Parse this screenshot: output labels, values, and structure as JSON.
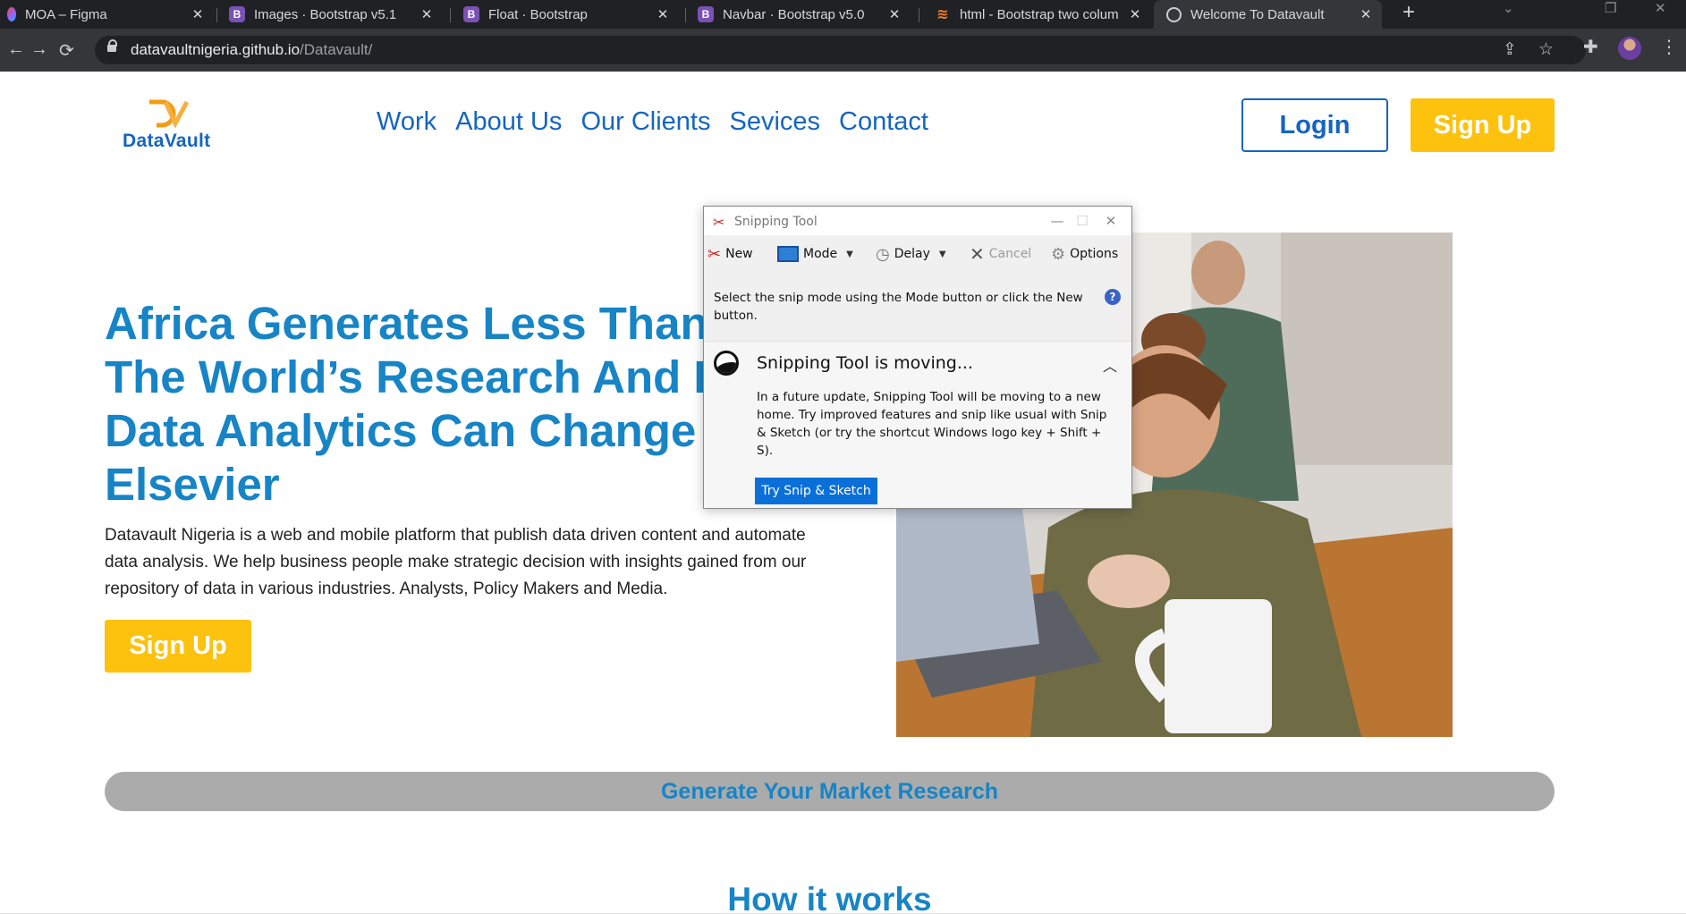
{
  "browser": {
    "tabs": [
      {
        "title": "MOA – Figma",
        "icon": "figma-icon"
      },
      {
        "title": "Images · Bootstrap v5.1",
        "icon": "bootstrap-icon"
      },
      {
        "title": "Float · Bootstrap",
        "icon": "bootstrap-icon"
      },
      {
        "title": "Navbar · Bootstrap v5.0",
        "icon": "bootstrap-icon"
      },
      {
        "title": "html - Bootstrap two colum",
        "icon": "stackoverflow-icon"
      },
      {
        "title": "Welcome To Datavault",
        "icon": "globe-icon",
        "active": true
      }
    ],
    "favicon_letter": "B",
    "url_host": "datavaultnigeria.github.io",
    "url_path": "/Datavault/"
  },
  "site": {
    "logo_text": "DataVault",
    "nav": [
      "Work",
      "About Us",
      "Our Clients",
      "Sevices",
      "Contact"
    ],
    "login_label": "Login",
    "signup_label": "Sign Up",
    "hero": {
      "title_lines": [
        "Africa Generates Less Than 1% Of",
        "The World’s Research And Data,",
        "Data Analytics Can Change That-",
        "Elsevier"
      ],
      "description": "Datavault Nigeria is a web and mobile platform that publish data driven content and automate data analysis. We help business people make strategic decision with insights gained from our repository of data in various industries. Analysts, Policy Makers and Media.",
      "cta_label": "Sign Up"
    },
    "market_research_label": "Generate Your Market Research",
    "how_it_works_title": "How it works",
    "colors": {
      "blue": "#1784c6",
      "nav_blue": "#1565c0",
      "yellow": "#fdc20e",
      "bar_gray": "#ababab"
    }
  },
  "snipping_tool": {
    "title": "Snipping Tool",
    "toolbar": {
      "new": "New",
      "mode": "Mode",
      "delay": "Delay",
      "cancel": "Cancel",
      "options": "Options"
    },
    "hint": "Select the snip mode using the Mode button or click the New button.",
    "panel_heading": "Snipping Tool is moving...",
    "panel_body": "In a future update, Snipping Tool will be moving to a new home. Try improved features and snip like usual with Snip & Sketch (or try the shortcut Windows logo key + Shift + S).",
    "try_button": "Try Snip & Sketch"
  }
}
